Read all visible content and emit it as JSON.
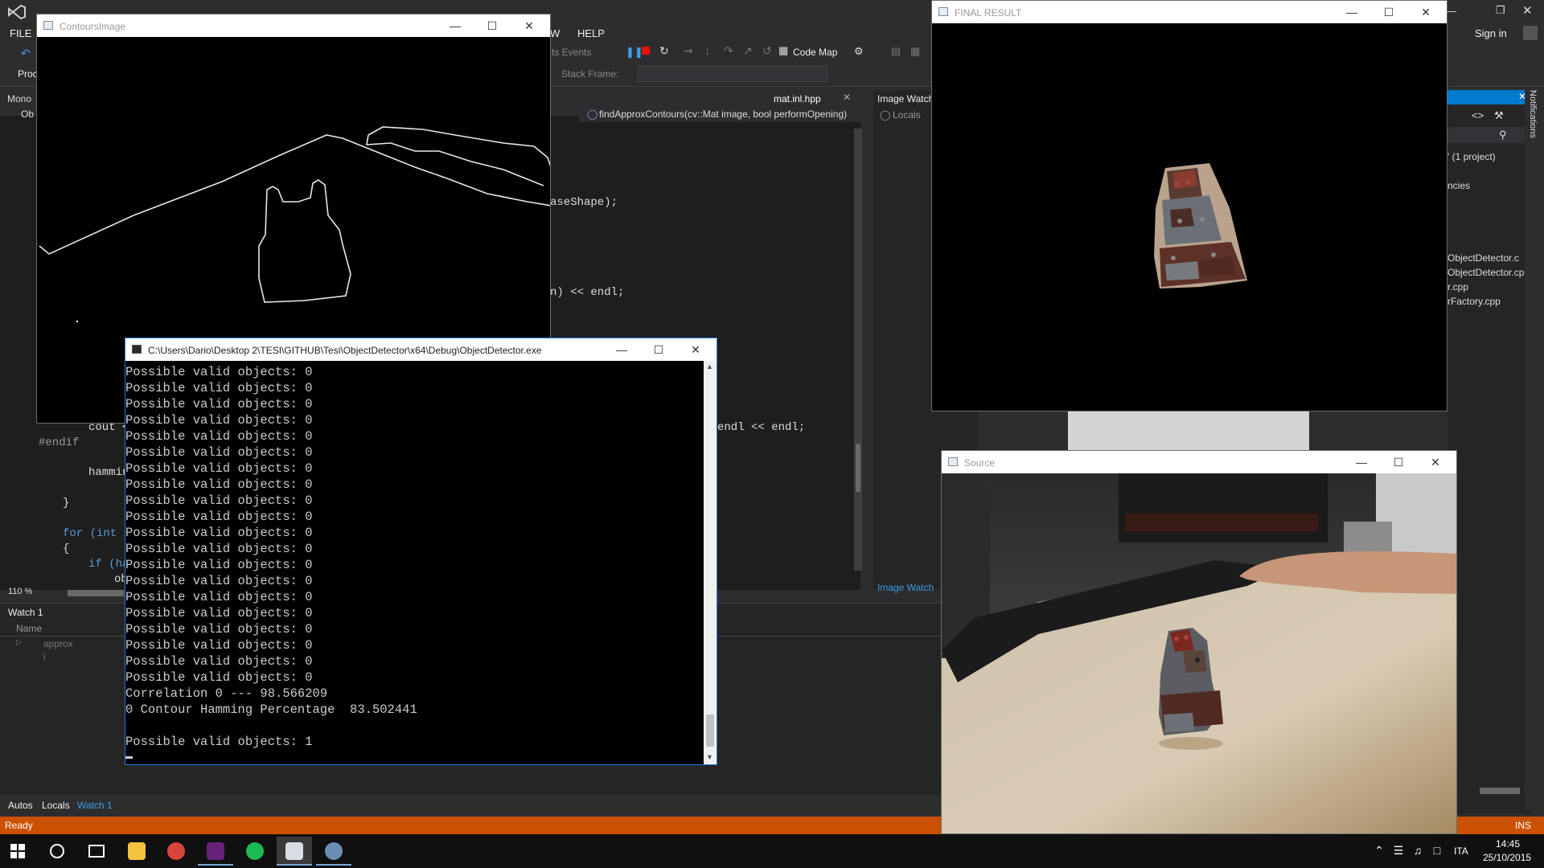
{
  "vs": {
    "menu": [
      "FILE",
      "W",
      "HELP"
    ],
    "toolbar": {
      "events_label": "ts Events",
      "code_map": "Code Map",
      "stack_frame": "Stack Frame:",
      "proc_label": "Proc"
    },
    "sign_in": "Sign in",
    "editor": {
      "file_tab": "mat.inl.hpp",
      "function_dropdown": "findApproxContours(cv::Mat image, bool performOpening)",
      "image_watch_tab": "Image Watch",
      "locals_label": "Locals",
      "zoom": "110 %",
      "left_tab": "Mono",
      "left_sub": "Ob",
      "code_lines": [
        {
          "text": "aseShape);"
        },
        {
          "text": "n) << endl;"
        },
        {
          "text": "endl << endl;"
        },
        {
          "text": "cout <"
        },
        {
          "text": "#endif"
        },
        {
          "text": "hammin"
        },
        {
          "text": "}"
        },
        {
          "text": "for (int i"
        },
        {
          "text": "{"
        },
        {
          "text": "if (ha"
        },
        {
          "text": "ob"
        }
      ],
      "image_watch_link": "Image Watch"
    },
    "solution": {
      "project": "' (1 project)",
      "deps": "ncies",
      "files": [
        "ObjectDetector.c",
        "ObjectDetector.cp",
        "r.cpp",
        "rFactory.cpp"
      ]
    },
    "notifications": "Notifications",
    "watch": {
      "title": "Watch 1",
      "column": "Name",
      "rows": [
        "approx",
        "i"
      ]
    },
    "bottom_tabs": [
      "Autos",
      "Locals",
      "Watch 1"
    ],
    "status": {
      "left": "Ready",
      "right": "INS"
    }
  },
  "contours_window": {
    "title": "ContoursImage"
  },
  "final_window": {
    "title": "FINAL RESULT"
  },
  "source_window": {
    "title": "Source"
  },
  "console": {
    "title": "C:\\Users\\Dario\\Desktop 2\\TESI\\GITHUB\\Tesi\\ObjectDetector\\x64\\Debug\\ObjectDetector.exe",
    "lines": [
      "Possible valid objects: 0",
      "Possible valid objects: 0",
      "Possible valid objects: 0",
      "Possible valid objects: 0",
      "Possible valid objects: 0",
      "Possible valid objects: 0",
      "Possible valid objects: 0",
      "Possible valid objects: 0",
      "Possible valid objects: 0",
      "Possible valid objects: 0",
      "Possible valid objects: 0",
      "Possible valid objects: 0",
      "Possible valid objects: 0",
      "Possible valid objects: 0",
      "Possible valid objects: 0",
      "Possible valid objects: 0",
      "Possible valid objects: 0",
      "Possible valid objects: 0",
      "Possible valid objects: 0",
      "Possible valid objects: 0",
      "Correlation 0 --- 98.566209",
      "0 Contour Hamming Percentage  83.502441",
      "",
      "Possible valid objects: 1"
    ]
  },
  "taskbar": {
    "time": "14:45",
    "date": "25/10/2015",
    "lang": "ITA"
  },
  "colors": {
    "status_orange": "#ca5100",
    "vs_dark": "#2d2d30",
    "vs_accent": "#007acc"
  }
}
